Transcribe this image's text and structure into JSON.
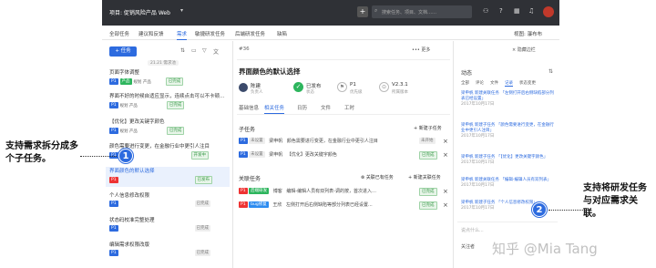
{
  "topbar": {
    "project_label": "项目: 促销风险产品 Web",
    "search_placeholder": "搜索任务、项目、文档……"
  },
  "nav": {
    "tabs": [
      "全部任务",
      "建议和反馈",
      "需求",
      "敏捷研发任务",
      "后端研发任务",
      "缺陷"
    ],
    "active": 2,
    "view_label": "视图: 瀑布布"
  },
  "left": {
    "new_button": "+ 任务",
    "group_header": "21.21 需求池",
    "items": [
      {
        "title": "页面字体调整",
        "p": "P1",
        "tag": "产品",
        "sub": "规划 产品",
        "status": "已完成"
      },
      {
        "title": "界面不好的时候自适应显示，连续点击可以不卡顿…",
        "p": "P1",
        "tag": "",
        "sub": "规划 产品",
        "status": "已完成"
      },
      {
        "title": "【优化】更改关键字颜色",
        "p": "P1",
        "tag": "",
        "sub": "规划 产品",
        "status": "已完成"
      },
      {
        "title": "颜色需要进行变更，在金融行业中更引人注目",
        "p": "P1",
        "tag": "",
        "sub": "",
        "status": "开发中"
      },
      {
        "title": "界面颜色的默认选择",
        "p": "P1",
        "tag": "",
        "sub": "",
        "status": "已发布"
      },
      {
        "title": "个人信息修改权限",
        "p": "P1",
        "tag": "",
        "sub": "",
        "status": "已完成"
      },
      {
        "title": "状态码校准完整处理",
        "p": "P1",
        "tag": "",
        "sub": "",
        "status": "已完成"
      },
      {
        "title": "编辑需求权限改版",
        "p": "P1",
        "tag": "",
        "sub": "",
        "status": "已完成"
      }
    ]
  },
  "mid": {
    "id": "#36",
    "title": "界面颜色的默认选择",
    "more": "••• 更多",
    "close": "× 隐藏边栏",
    "assignee_name": "陈建",
    "assignee_role": "负责人",
    "status_value": "已发布",
    "status_label": "状态",
    "priority_value": "P1",
    "priority_label": "优先级",
    "version_value": "V2.3.1",
    "version_label": "所属版本",
    "tabs": [
      "基础信息",
      "相关任务",
      "日历",
      "文件",
      "工时"
    ],
    "subtasks_title": "子任务",
    "new_subtask": "+ 新建子任务",
    "subtasks": [
      {
        "p": "P1",
        "tag": "未设置",
        "owner": "梁申帆",
        "text": "颜色需要进行变更，在金融行业中更引人注目",
        "state": "未开始"
      },
      {
        "p": "P1",
        "tag": "未设置",
        "owner": "梁申帆",
        "text": "【优化】更改关键字颜色",
        "state": "已完成"
      }
    ],
    "related_title": "关联任务",
    "related_actions": [
      "⊗ 关联已有任务",
      "+ 新建关联任务"
    ],
    "related": [
      {
        "p": "P1",
        "tag": "后端研发",
        "owner": "博客",
        "text": "编辑-编辑人员有双列表-调的按，首次进入…",
        "state": "已完成"
      },
      {
        "p": "P1",
        "tag": "bug修复",
        "owner": "王欣",
        "text": "左侧打开后右侧缺陷等部分列表已经设置...",
        "state": "已完成"
      }
    ]
  },
  "right": {
    "title": "动态",
    "tabs": [
      "全部",
      "评论",
      "文件",
      "记录",
      "状态变更"
    ],
    "activities": [
      {
        "text": "梁申帆 新建关联任务 「左侧打开后右侧缺陷部分列表已经设置」",
        "date": "2017年10月17日"
      },
      {
        "text": "梁申帆 新建子任务 「颜色需要进行变更，在金融行业中更引人注目」",
        "date": "2017年10月17日"
      },
      {
        "text": "梁申帆 新建子任务 「【优化】更改关键字颜色」",
        "date": "2017年10月17日"
      },
      {
        "text": "梁申帆 新建关联任务 「编辑-编辑人员有双列表」",
        "date": "2017年10月17日"
      },
      {
        "text": "梁申帆 新建子任务 「个人信息修改权限」",
        "date": "2017年10月17日"
      }
    ],
    "comment_placeholder": "说点什么...",
    "followers": "关注者"
  },
  "annotations": {
    "left_text": "支持需求拆分成多个子任务。",
    "right_text": "支持将研发任务与对应需求关联。",
    "badge1": "1",
    "badge2": "2",
    "watermark": "知乎 @Mia Tang"
  }
}
